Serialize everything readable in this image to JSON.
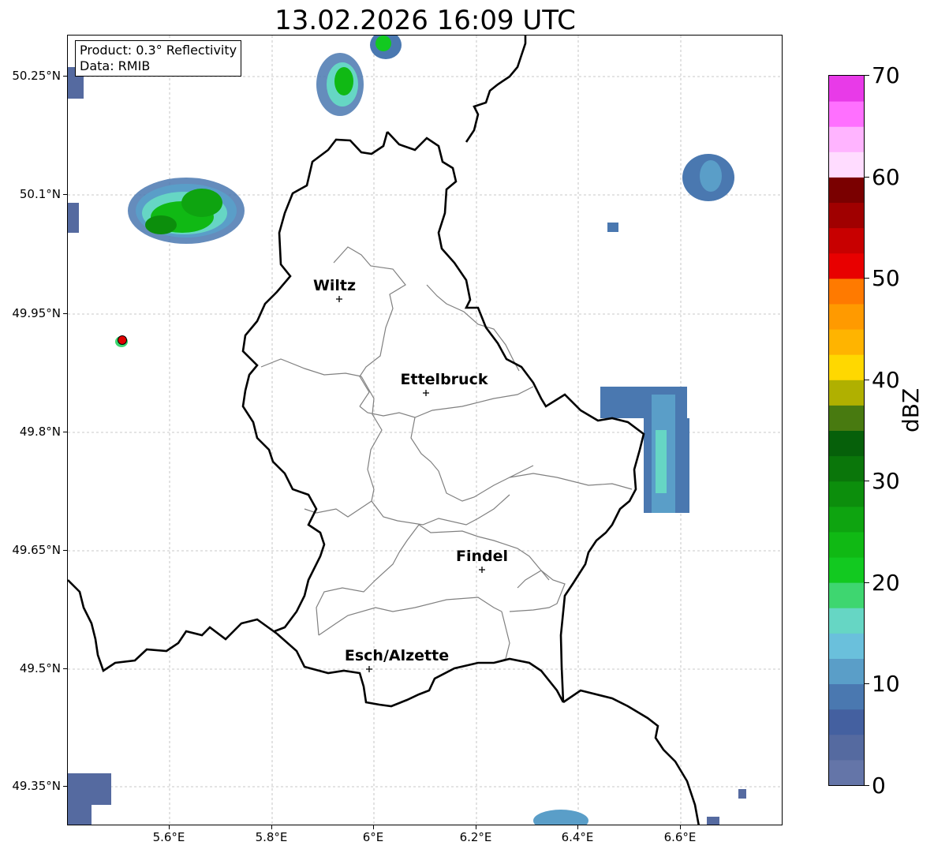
{
  "title": "13.02.2026 16:09 UTC",
  "info": {
    "product": "Product: 0.3° Reflectivity",
    "data": "Data: RMIB"
  },
  "lat_ticks": [
    "50.25°N",
    "50.1°N",
    "49.95°N",
    "49.8°N",
    "49.65°N",
    "49.5°N",
    "49.35°N"
  ],
  "lon_ticks": [
    "5.6°E",
    "5.8°E",
    "6°E",
    "6.2°E",
    "6.4°E",
    "6.6°E"
  ],
  "cities": {
    "wiltz": "Wiltz",
    "ettelbruck": "Ettelbruck",
    "findel": "Findel",
    "esch": "Esch/Alzette"
  },
  "colorbar": {
    "label": "dBZ",
    "ticks": [
      "0",
      "10",
      "20",
      "30",
      "40",
      "50",
      "60",
      "70"
    ],
    "colors": [
      "#6475a8",
      "#556aa0",
      "#4460a0",
      "#4a78b0",
      "#5a9ec8",
      "#6ac0dc",
      "#66d6c4",
      "#3ed670",
      "#12c920",
      "#10b914",
      "#0ea410",
      "#0c8e0c",
      "#0a760a",
      "#06600a",
      "#487a10",
      "#b0b000",
      "#ffd800",
      "#ffb400",
      "#ff9a00",
      "#ff7a00",
      "#e80000",
      "#c80000",
      "#a00000",
      "#7a0000",
      "#ffdcff",
      "#ffb4ff",
      "#ff70ff",
      "#e83ae8"
    ]
  },
  "colors": {
    "border": "#000000",
    "canton_line": "#808080",
    "gridline": "#b8b8b8",
    "radar_marker": "#e00000"
  }
}
